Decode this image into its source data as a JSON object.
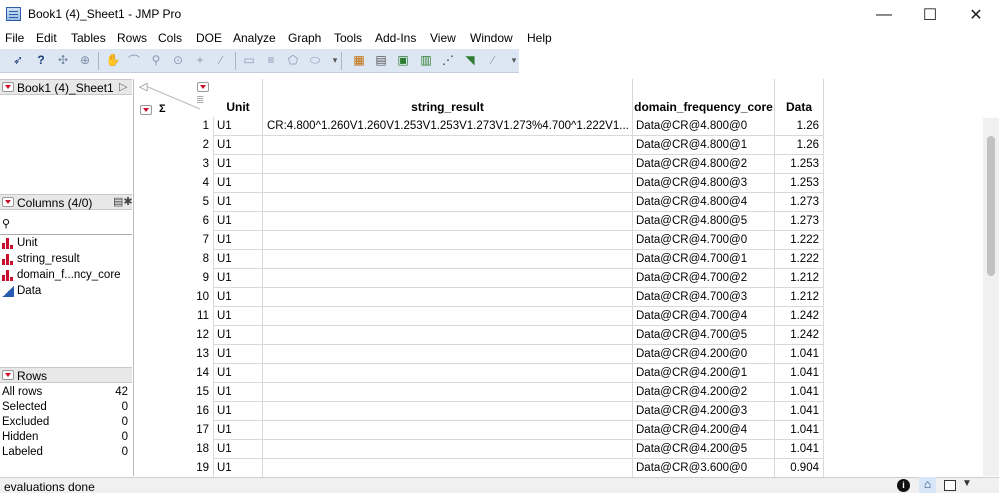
{
  "window": {
    "title": "Book1 (4)_Sheet1 - JMP Pro",
    "minimize": "—",
    "maximize": "☐",
    "close": "✕"
  },
  "menu": [
    "File",
    "Edit",
    "Tables",
    "Rows",
    "Cols",
    "DOE",
    "Analyze",
    "Graph",
    "Tools",
    "Add-Ins",
    "View",
    "Window",
    "Help"
  ],
  "left": {
    "table_name": "Book1 (4)_Sheet1",
    "columns_header": "Columns (4/0)",
    "search_icon": "magnifier-icon",
    "columns": [
      {
        "name": "Unit",
        "type": "nominal"
      },
      {
        "name": "string_result",
        "type": "nominal"
      },
      {
        "name": "domain_f...ncy_core",
        "type": "nominal"
      },
      {
        "name": "Data",
        "type": "continuous"
      }
    ],
    "rows_header": "Rows",
    "rows_stats": [
      {
        "label": "All rows",
        "value": "42"
      },
      {
        "label": "Selected",
        "value": "0"
      },
      {
        "label": "Excluded",
        "value": "0"
      },
      {
        "label": "Hidden",
        "value": "0"
      },
      {
        "label": "Labeled",
        "value": "0"
      }
    ]
  },
  "grid": {
    "headers": {
      "unit": "Unit",
      "string": "string_result",
      "domain": "domain_frequency_core",
      "data": "Data"
    },
    "rows": [
      {
        "n": "1",
        "unit": "U1",
        "string": "CR:4.800^1.260V1.260V1.253V1.253V1.273V1.273%4.700^1.222V1...",
        "domain": "Data@CR@4.800@0",
        "data": "1.26"
      },
      {
        "n": "2",
        "unit": "U1",
        "string": "",
        "domain": "Data@CR@4.800@1",
        "data": "1.26"
      },
      {
        "n": "3",
        "unit": "U1",
        "string": "",
        "domain": "Data@CR@4.800@2",
        "data": "1.253"
      },
      {
        "n": "4",
        "unit": "U1",
        "string": "",
        "domain": "Data@CR@4.800@3",
        "data": "1.253"
      },
      {
        "n": "5",
        "unit": "U1",
        "string": "",
        "domain": "Data@CR@4.800@4",
        "data": "1.273"
      },
      {
        "n": "6",
        "unit": "U1",
        "string": "",
        "domain": "Data@CR@4.800@5",
        "data": "1.273"
      },
      {
        "n": "7",
        "unit": "U1",
        "string": "",
        "domain": "Data@CR@4.700@0",
        "data": "1.222"
      },
      {
        "n": "8",
        "unit": "U1",
        "string": "",
        "domain": "Data@CR@4.700@1",
        "data": "1.222"
      },
      {
        "n": "9",
        "unit": "U1",
        "string": "",
        "domain": "Data@CR@4.700@2",
        "data": "1.212"
      },
      {
        "n": "10",
        "unit": "U1",
        "string": "",
        "domain": "Data@CR@4.700@3",
        "data": "1.212"
      },
      {
        "n": "11",
        "unit": "U1",
        "string": "",
        "domain": "Data@CR@4.700@4",
        "data": "1.242"
      },
      {
        "n": "12",
        "unit": "U1",
        "string": "",
        "domain": "Data@CR@4.700@5",
        "data": "1.242"
      },
      {
        "n": "13",
        "unit": "U1",
        "string": "",
        "domain": "Data@CR@4.200@0",
        "data": "1.041"
      },
      {
        "n": "14",
        "unit": "U1",
        "string": "",
        "domain": "Data@CR@4.200@1",
        "data": "1.041"
      },
      {
        "n": "15",
        "unit": "U1",
        "string": "",
        "domain": "Data@CR@4.200@2",
        "data": "1.041"
      },
      {
        "n": "16",
        "unit": "U1",
        "string": "",
        "domain": "Data@CR@4.200@3",
        "data": "1.041"
      },
      {
        "n": "17",
        "unit": "U1",
        "string": "",
        "domain": "Data@CR@4.200@4",
        "data": "1.041"
      },
      {
        "n": "18",
        "unit": "U1",
        "string": "",
        "domain": "Data@CR@4.200@5",
        "data": "1.041"
      },
      {
        "n": "19",
        "unit": "U1",
        "string": "",
        "domain": "Data@CR@3.600@0",
        "data": "0.904"
      }
    ]
  },
  "status": {
    "text": "evaluations done",
    "icons": [
      "info-icon",
      "home-icon",
      "checkbox-icon",
      "dropdown-icon"
    ]
  },
  "colors": {
    "toolbar": "#dde6f3",
    "accent_red": "#c8102e",
    "continuous_blue": "#2a5db0"
  }
}
